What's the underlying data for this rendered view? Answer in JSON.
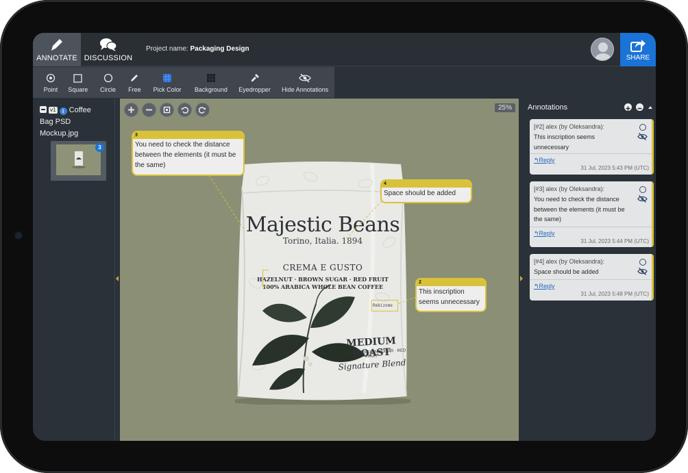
{
  "nav": {
    "annotate_label": "ANNOTATE",
    "discussion_label": "DISCUSSION",
    "project_prefix": "Project name:",
    "project_name": "Packaging Design",
    "share_label": "SHARE"
  },
  "toolbar": {
    "tools": [
      {
        "label": "Point",
        "icon": "point-icon"
      },
      {
        "label": "Square",
        "icon": "square-icon"
      },
      {
        "label": "Circle",
        "icon": "circle-icon"
      },
      {
        "label": "Free",
        "icon": "pencil-icon"
      },
      {
        "label": "Pick Color",
        "icon": "color-swatch-icon"
      },
      {
        "label": "Background",
        "icon": "background-icon"
      },
      {
        "label": "Eyedropper",
        "icon": "eyedropper-icon"
      },
      {
        "label": "Hide Annotations",
        "icon": "eye-slash-icon"
      }
    ]
  },
  "files": {
    "version": "v1",
    "file_name_line1": "Coffee",
    "file_name_line2": "Bag PSD",
    "file_name_line3": "Mockup.jpg",
    "annotation_count": "3"
  },
  "canvas": {
    "zoom": "25%",
    "bag": {
      "brand": "Majestic Beans",
      "origin": "Torino, Italia. 1894",
      "product": "CREMA E GUSTO",
      "notes": "HAZELNUT · BROWN SUGAR · RED FRUIT",
      "blend": "100% ARABICA WHOLE BEAN COFFEE",
      "tag": "Rebizome",
      "roast": "MEDIUM ROAST",
      "roast_sub": "HAZELNUT · BROWN SUGAR · RED FRUIT",
      "signature": "Signature Blend"
    },
    "notes": [
      {
        "number": "3",
        "text": "You need to check the distance between the elements (it must be the same)"
      },
      {
        "number": "4",
        "text": "Space should be added"
      },
      {
        "number": "2",
        "text": "This inscription seems unnecessary"
      }
    ]
  },
  "annotations": {
    "title": "Annotations",
    "items": [
      {
        "meta": "[#2] alex (by Oleksandra):",
        "text": "This inscription seems unnecessary",
        "reply": "Reply",
        "time": "31 Jul, 2023 5:43 PM (UTC)"
      },
      {
        "meta": "[#3] alex (by Oleksandra):",
        "text": "You need to check the distance between the elements (it must be the same)",
        "reply": "Reply",
        "time": "31 Jul, 2023 5:44 PM (UTC)"
      },
      {
        "meta": "[#4] alex (by Oleksandra):",
        "text": "Space should be added",
        "reply": "Reply",
        "time": "31 Jul, 2023 5:48 PM (UTC)"
      }
    ]
  },
  "colors": {
    "accent_blue": "#1a73d6",
    "annotation_yellow": "#d9c23a",
    "canvas_bg": "#8b8f76",
    "panel_bg": "#2b3138"
  }
}
